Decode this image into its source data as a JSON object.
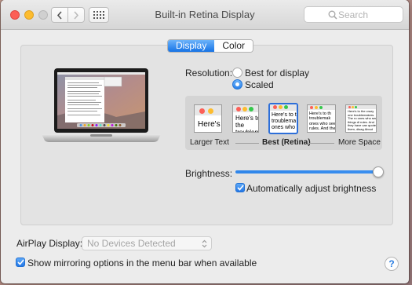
{
  "window": {
    "title": "Built-in Retina Display",
    "search_placeholder": "Search"
  },
  "tabs": [
    {
      "label": "Display",
      "selected": true
    },
    {
      "label": "Color",
      "selected": false
    }
  ],
  "resolution": {
    "label": "Resolution:",
    "options": [
      {
        "label": "Best for display",
        "selected": false
      },
      {
        "label": "Scaled",
        "selected": true
      }
    ],
    "scale_options": {
      "selected": "Best (Retina)",
      "thumb_texts": [
        "Here's",
        "Here's to the troublem",
        "Here's to th troublema ones who",
        "Here's to th troublemak ones who see rules. And the",
        "Here's to the crazy one troublemakers. The ro ones who see things di rules. And they have can quote them, disag About the only thing y Because they change"
      ],
      "labels": {
        "left": "Larger Text",
        "center": "Best (Retina)",
        "right": "More Space"
      }
    }
  },
  "brightness": {
    "label": "Brightness:",
    "level": 1.0,
    "auto_label": "Automatically adjust brightness",
    "auto_checked": true
  },
  "airplay": {
    "label": "AirPlay Display:",
    "value": "No Devices Detected"
  },
  "mirroring": {
    "label": "Show mirroring options in the menu bar when available",
    "checked": true
  },
  "help": {
    "label": "?"
  },
  "colors": {
    "accent": "#2a82ea",
    "close": "#fc5f57",
    "minimize": "#fdbc2e",
    "zoom_disabled": "#d0d0d0"
  }
}
